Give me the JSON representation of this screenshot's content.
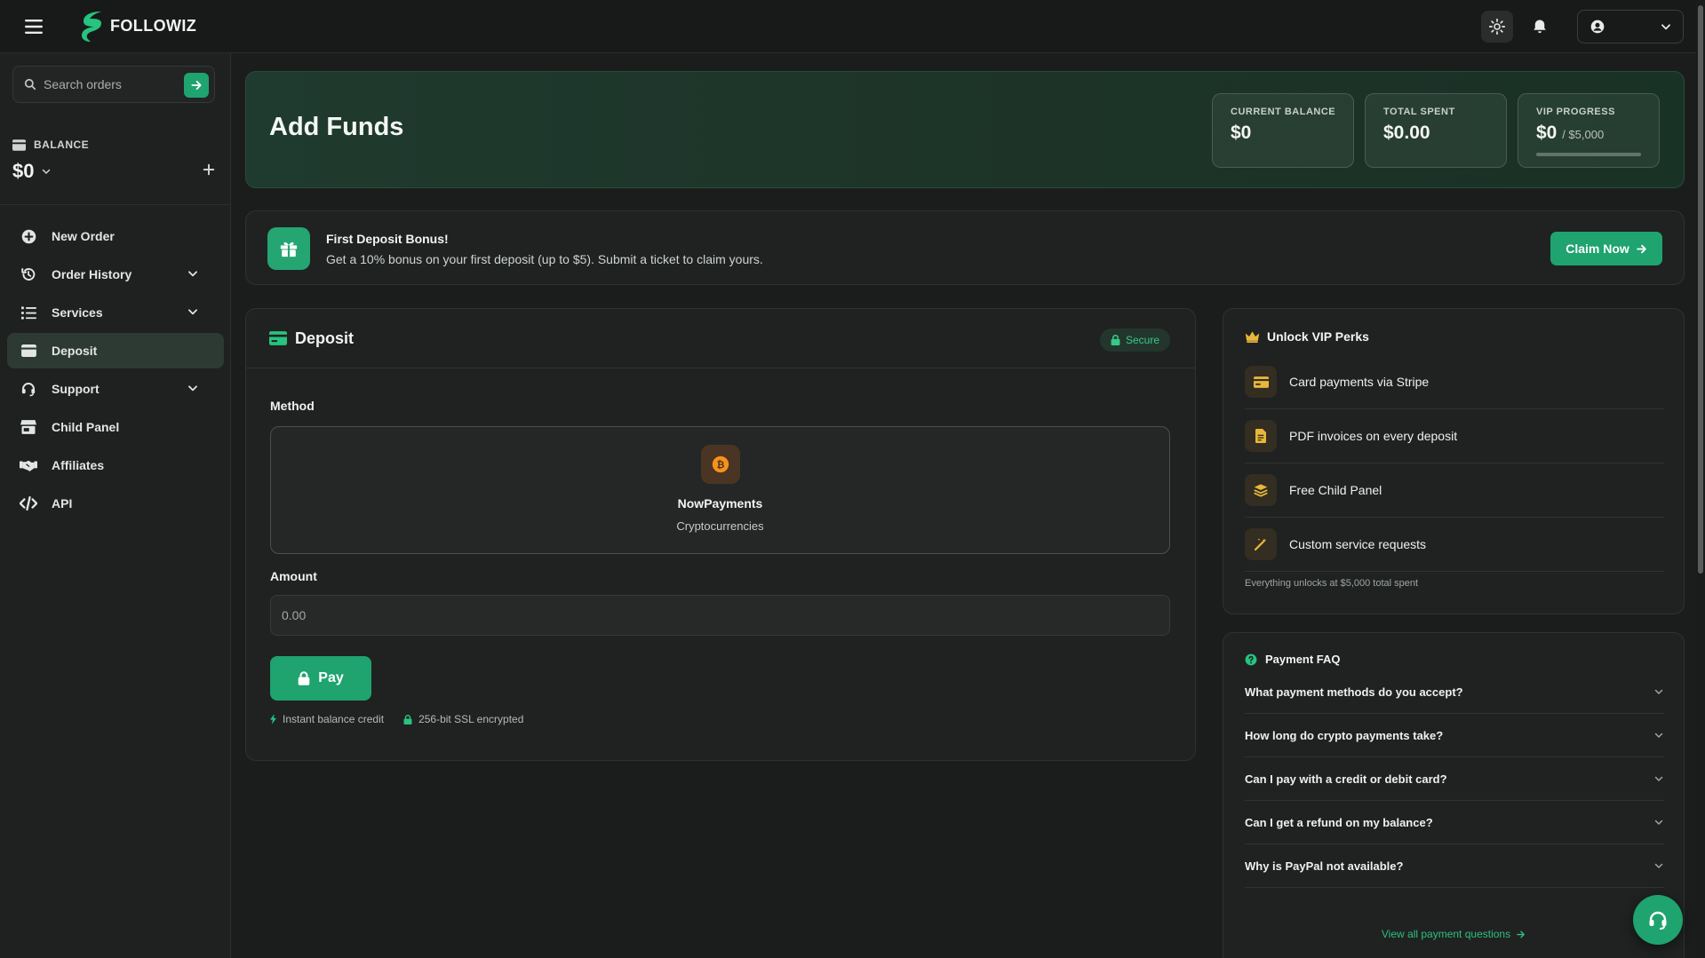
{
  "brand": {
    "name": "FOLLOWIZ"
  },
  "colors": {
    "accent": "#1fa36f",
    "background": "#1b1d1c",
    "header_gradient": "#1f3a2e"
  },
  "topbar": {
    "icons": [
      "menu-icon",
      "settings-icon",
      "bell-icon",
      "user-icon",
      "chevron-down-icon"
    ]
  },
  "sidebar": {
    "search": {
      "placeholder": "Search orders",
      "value": ""
    },
    "balance": {
      "label": "BALANCE",
      "value": "$0"
    },
    "nav": [
      {
        "label": "New Order",
        "icon": "plus-circle-icon",
        "has_children": false,
        "active": false
      },
      {
        "label": "Order History",
        "icon": "history-icon",
        "has_children": true,
        "active": false
      },
      {
        "label": "Services",
        "icon": "list-icon",
        "has_children": true,
        "active": false
      },
      {
        "label": "Deposit",
        "icon": "wallet-icon",
        "has_children": false,
        "active": true
      },
      {
        "label": "Support",
        "icon": "headset-icon",
        "has_children": true,
        "active": false
      },
      {
        "label": "Child Panel",
        "icon": "store-icon",
        "has_children": false,
        "active": false
      },
      {
        "label": "Affiliates",
        "icon": "handshake-icon",
        "has_children": false,
        "active": false
      },
      {
        "label": "API",
        "icon": "code-icon",
        "has_children": false,
        "active": false
      }
    ]
  },
  "header": {
    "title": "Add Funds",
    "stats": {
      "current_balance": {
        "label": "CURRENT BALANCE",
        "value": "$0"
      },
      "total_spent": {
        "label": "TOTAL SPENT",
        "value": "$0.00"
      },
      "vip_progress": {
        "label": "VIP PROGRESS",
        "value": "$0",
        "target": "/ $5,000",
        "progress": 0
      }
    }
  },
  "bonus": {
    "title": "First Deposit Bonus!",
    "text": "Get a 10% bonus on your first deposit (up to $5). Submit a ticket to claim yours.",
    "button": "Claim Now"
  },
  "deposit": {
    "title": "Deposit",
    "badge": "Secure",
    "method_label": "Method",
    "method": {
      "name": "NowPayments",
      "subtitle": "Cryptocurrencies",
      "icon": "bitcoin-icon"
    },
    "amount_label": "Amount",
    "amount_placeholder": "0.00",
    "pay_button": "Pay",
    "notes": [
      "Instant balance credit",
      "256-bit SSL encrypted"
    ]
  },
  "vip": {
    "title": "Unlock VIP Perks",
    "perks": [
      {
        "label": "Card payments via Stripe",
        "icon": "card-icon"
      },
      {
        "label": "PDF invoices on every deposit",
        "icon": "invoice-icon"
      },
      {
        "label": "Free Child Panel",
        "icon": "layers-icon"
      },
      {
        "label": "Custom service requests",
        "icon": "magic-wand-icon"
      }
    ],
    "footnote": "Everything unlocks at $5,000 total spent"
  },
  "faq": {
    "title": "Payment FAQ",
    "items": [
      "What payment methods do you accept?",
      "How long do crypto payments take?",
      "Can I pay with a credit or debit card?",
      "Can I get a refund on my balance?",
      "Why is PayPal not available?"
    ],
    "link": "View all payment questions"
  }
}
